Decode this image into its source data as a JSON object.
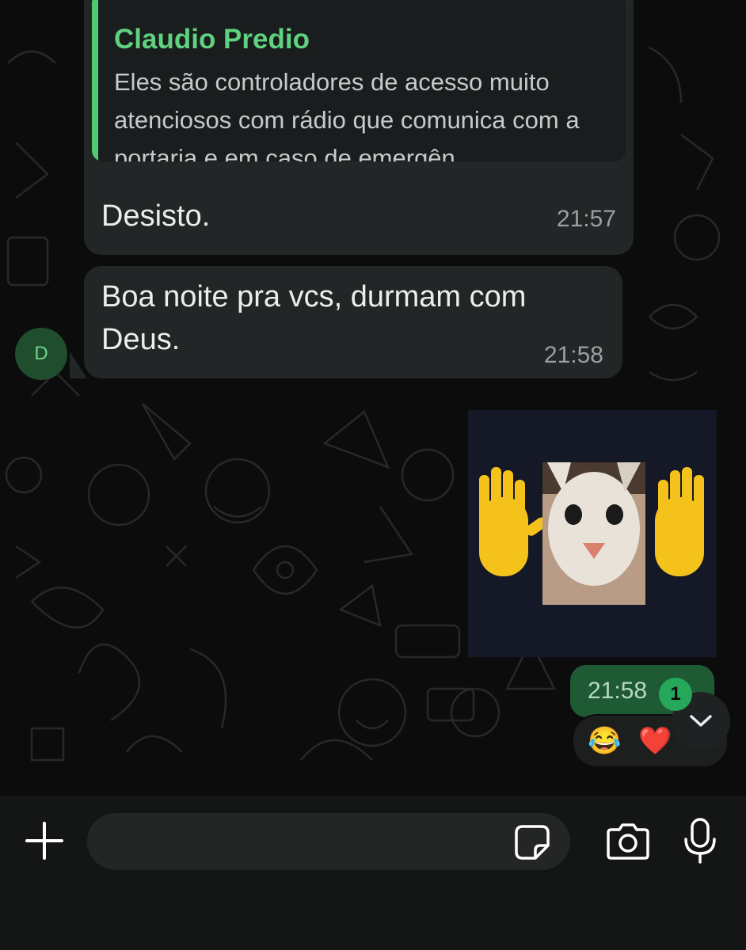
{
  "messages": [
    {
      "quote_author": "Claudio Predio",
      "quote_text": "Eles são controladores de acesso muito atenciosos com rádio que comunica com a portaria e em caso de emergên...",
      "text": "Desisto.",
      "time": "21:57"
    },
    {
      "text": "Boa noite pra vcs, durmam com Deus.",
      "time": "21:58"
    }
  ],
  "avatar_initial": "D",
  "sent": {
    "time": "21:58",
    "reactions": [
      "😂",
      "❤️"
    ],
    "unread_badge": "1"
  },
  "composer": {
    "placeholder": ""
  },
  "colors": {
    "accent": "#4ecb71",
    "bubble_in": "#232626",
    "bubble_out": "#1e5b35"
  },
  "icons": [
    "plus-icon",
    "sticker-icon",
    "camera-icon",
    "mic-icon",
    "chevron-down-icon"
  ]
}
